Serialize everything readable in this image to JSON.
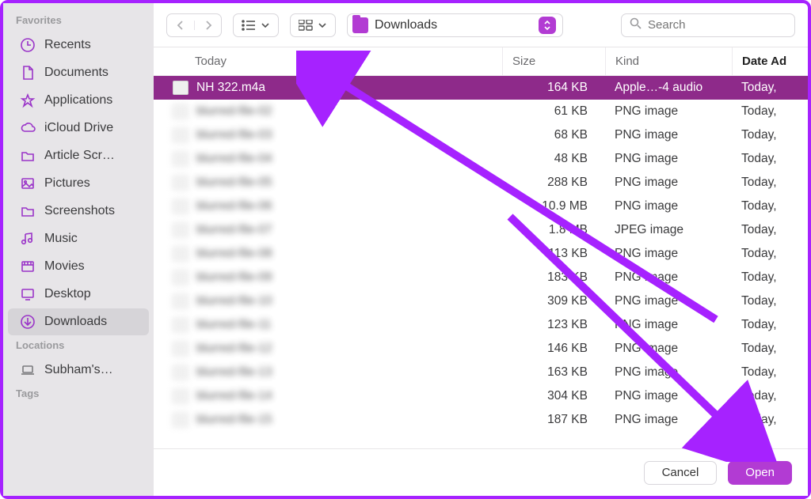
{
  "sidebar": {
    "sections": [
      {
        "title": "Favorites",
        "items": [
          {
            "id": "recents",
            "label": "Recents",
            "icon": "clock-icon"
          },
          {
            "id": "documents",
            "label": "Documents",
            "icon": "doc-icon"
          },
          {
            "id": "applications",
            "label": "Applications",
            "icon": "apps-icon"
          },
          {
            "id": "icloud",
            "label": "iCloud Drive",
            "icon": "cloud-icon"
          },
          {
            "id": "article",
            "label": "Article Scr…",
            "icon": "folder-icon"
          },
          {
            "id": "pictures",
            "label": "Pictures",
            "icon": "picture-icon"
          },
          {
            "id": "screenshots",
            "label": "Screenshots",
            "icon": "folder-icon"
          },
          {
            "id": "music",
            "label": "Music",
            "icon": "music-icon"
          },
          {
            "id": "movies",
            "label": "Movies",
            "icon": "movies-icon"
          },
          {
            "id": "desktop",
            "label": "Desktop",
            "icon": "desktop-icon"
          },
          {
            "id": "downloads",
            "label": "Downloads",
            "icon": "download-icon",
            "selected": true
          }
        ]
      },
      {
        "title": "Locations",
        "items": [
          {
            "id": "machine",
            "label": "Subham's…",
            "icon": "laptop-icon",
            "mono": true
          }
        ]
      },
      {
        "title": "Tags",
        "items": []
      }
    ]
  },
  "toolbar": {
    "folder_label": "Downloads",
    "search_placeholder": "Search"
  },
  "columns": {
    "name": "Today",
    "size": "Size",
    "kind": "Kind",
    "date": "Date Ad"
  },
  "rows": [
    {
      "name": "NH 322.m4a",
      "size": "164 KB",
      "kind": "Apple…-4 audio",
      "date": "Today,",
      "selected": true
    },
    {
      "name": "blurred-file-02",
      "size": "61 KB",
      "kind": "PNG image",
      "date": "Today,",
      "blur": true
    },
    {
      "name": "blurred-file-03",
      "size": "68 KB",
      "kind": "PNG image",
      "date": "Today,",
      "blur": true
    },
    {
      "name": "blurred-file-04",
      "size": "48 KB",
      "kind": "PNG image",
      "date": "Today,",
      "blur": true
    },
    {
      "name": "blurred-file-05",
      "size": "288 KB",
      "kind": "PNG image",
      "date": "Today,",
      "blur": true
    },
    {
      "name": "blurred-file-06",
      "size": "10.9 MB",
      "kind": "PNG image",
      "date": "Today,",
      "blur": true
    },
    {
      "name": "blurred-file-07",
      "size": "1.8 MB",
      "kind": "JPEG image",
      "date": "Today,",
      "blur": true
    },
    {
      "name": "blurred-file-08",
      "size": "113 KB",
      "kind": "PNG image",
      "date": "Today,",
      "blur": true
    },
    {
      "name": "blurred-file-09",
      "size": "183 KB",
      "kind": "PNG image",
      "date": "Today,",
      "blur": true
    },
    {
      "name": "blurred-file-10",
      "size": "309 KB",
      "kind": "PNG image",
      "date": "Today,",
      "blur": true
    },
    {
      "name": "blurred-file-11",
      "size": "123 KB",
      "kind": "PNG image",
      "date": "Today,",
      "blur": true
    },
    {
      "name": "blurred-file-12",
      "size": "146 KB",
      "kind": "PNG image",
      "date": "Today,",
      "blur": true
    },
    {
      "name": "blurred-file-13",
      "size": "163 KB",
      "kind": "PNG image",
      "date": "Today,",
      "blur": true
    },
    {
      "name": "blurred-file-14",
      "size": "304 KB",
      "kind": "PNG image",
      "date": "Today,",
      "blur": true
    },
    {
      "name": "blurred-file-15",
      "size": "187 KB",
      "kind": "PNG image",
      "date": "Today,",
      "blur": true
    }
  ],
  "footer": {
    "cancel": "Cancel",
    "open": "Open"
  },
  "accent": "#a622ff"
}
